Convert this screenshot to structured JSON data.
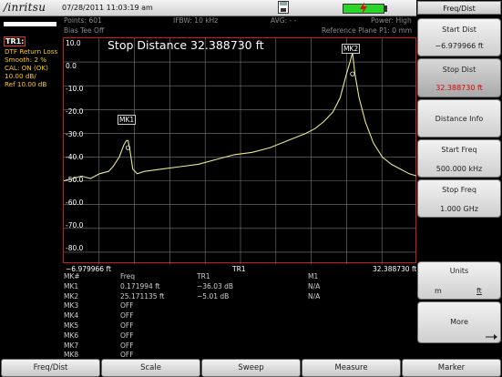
{
  "topbar": {
    "logo": "/inritsu",
    "datetime": "07/28/2011 11:03:19 am"
  },
  "status": {
    "title": "TR1:",
    "lines": [
      "DTF Return Loss",
      "Smooth: 2 %",
      "CAL: ON (OK)",
      "10.00 dB/",
      "Ref 10.00 dB"
    ]
  },
  "info": {
    "points": "Points: 601",
    "bias_tee": "Bias Tee Off",
    "ifbw": "IFBW: 10 kHz",
    "avg": "AVG: - -",
    "power": "Power: High",
    "ref_plane": "Reference Plane P1: 0 mm"
  },
  "plot": {
    "title": "Stop Distance 32.388730 ft",
    "x_start_label": "−6.979966 ft",
    "x_center_label": "TR1",
    "x_stop_label": "32.388730 ft",
    "y_ticks": [
      "10.0",
      "0.0",
      "-10.0",
      "-20.0",
      "-30.0",
      "-40.0",
      "-50.0",
      "-60.0",
      "-70.0",
      "-80.0"
    ],
    "marker_labels": [
      "MK1",
      "MK2"
    ]
  },
  "chart_data": {
    "type": "line",
    "title": "Stop Distance 32.388730 ft",
    "xlim": [
      -6.979966,
      32.38873
    ],
    "ylim": [
      -85,
      10
    ],
    "x": [
      -6.98,
      -6.0,
      -5.0,
      -4.0,
      -3.0,
      -2.0,
      -1.5,
      -0.8,
      -0.3,
      0.0,
      0.17,
      0.35,
      0.7,
      1.2,
      2.0,
      4.0,
      6.0,
      8.0,
      10.0,
      12.0,
      14.0,
      16.0,
      18.0,
      20.0,
      21.0,
      22.0,
      23.0,
      23.8,
      24.5,
      24.9,
      25.17,
      25.45,
      25.9,
      26.6,
      27.5,
      28.5,
      29.5,
      30.5,
      31.5,
      32.39
    ],
    "y": [
      -50,
      -49,
      -48,
      -49,
      -47,
      -46,
      -44,
      -40,
      -35,
      -33,
      -33,
      -36,
      -45,
      -47,
      -46,
      -45,
      -44,
      -43,
      -41,
      -39,
      -38,
      -36,
      -33,
      -30,
      -28,
      -25,
      -21,
      -15,
      -5,
      0,
      4,
      -5,
      -15,
      -25,
      -34,
      -40,
      -43,
      -45,
      -47,
      -48
    ],
    "markers": [
      {
        "name": "MK1",
        "x": 0.171994,
        "y": -36.03
      },
      {
        "name": "MK2",
        "x": 25.171135,
        "y": -5.01
      }
    ]
  },
  "marker_table": {
    "headers": [
      "MK#",
      "Freq",
      "TR1",
      "M1"
    ],
    "rows": [
      [
        "MK1",
        "0.171994 ft",
        "−36.03 dB",
        "N/A"
      ],
      [
        "MK2",
        "25.171135 ft",
        "−5.01 dB",
        "N/A"
      ],
      [
        "MK3",
        "OFF",
        "",
        ""
      ],
      [
        "MK4",
        "OFF",
        "",
        ""
      ],
      [
        "MK5",
        "OFF",
        "",
        ""
      ],
      [
        "MK6",
        "OFF",
        "",
        ""
      ],
      [
        "MK7",
        "OFF",
        "",
        ""
      ],
      [
        "MK8",
        "OFF",
        "",
        ""
      ]
    ]
  },
  "softkeys": {
    "title": "Freq/Dist",
    "keys": [
      {
        "label": "Start Dist",
        "value": "−6.979966 ft"
      },
      {
        "label": "Stop Dist",
        "value": "32.388730 ft"
      },
      {
        "label": "Distance Info",
        "value": ""
      },
      {
        "label": "Start Freq",
        "value": "500.000 kHz"
      },
      {
        "label": "Stop Freq",
        "value": "1.000 GHz"
      },
      {
        "label": "Units",
        "value": ""
      },
      {
        "label": "More",
        "value": ""
      }
    ],
    "units_options": [
      "m",
      "ft"
    ]
  },
  "bottom_menu": [
    "Freq/Dist",
    "Scale",
    "Sweep",
    "Measure",
    "Marker"
  ],
  "colors": {
    "trace": "#e8e890",
    "grid": "#7a7a7a",
    "plot_border": "#d01818",
    "status_text": "#ffcc00",
    "active_value": "#e00000"
  }
}
